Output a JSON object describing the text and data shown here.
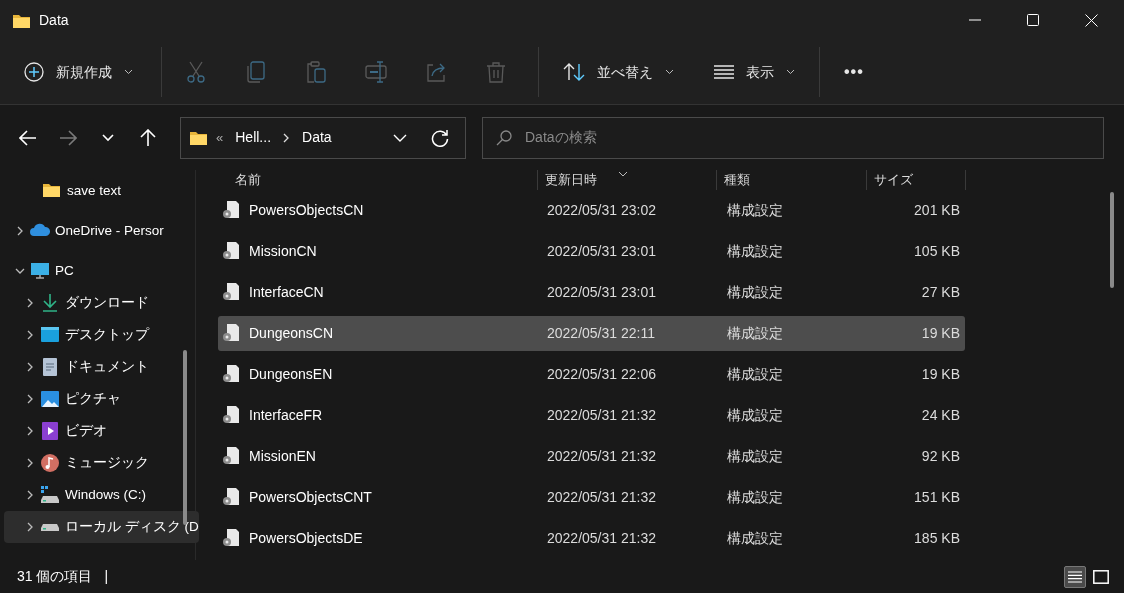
{
  "window": {
    "title": "Data"
  },
  "toolbar": [
    {
      "kind": "new",
      "label": "新規作成",
      "disabled": false
    },
    {
      "kind": "cut",
      "disabled": true
    },
    {
      "kind": "copy",
      "disabled": true
    },
    {
      "kind": "paste",
      "disabled": true
    },
    {
      "kind": "rename",
      "disabled": true
    },
    {
      "kind": "share",
      "disabled": true
    },
    {
      "kind": "delete",
      "disabled": true
    },
    {
      "kind": "sort",
      "label": "並べ替え",
      "disabled": false
    },
    {
      "kind": "view",
      "label": "表示",
      "disabled": false
    },
    {
      "kind": "more",
      "label": "•••",
      "disabled": false
    }
  ],
  "navigation": [
    {
      "kind": "back",
      "disabled": false
    },
    {
      "kind": "forward",
      "disabled": true
    },
    {
      "kind": "recent",
      "disabled": false
    },
    {
      "kind": "up",
      "disabled": false
    }
  ],
  "address_bar": {
    "overflow": "«",
    "crumbs": [
      "Hell...",
      "Data"
    ]
  },
  "search": {
    "placeholder": "Dataの検索"
  },
  "sidebar": {
    "items": [
      {
        "kind": "folder",
        "label": "save text",
        "selected": false
      },
      {
        "kind": "cloud",
        "label": "OneDrive - Persor",
        "expanded": false,
        "selected": false
      },
      {
        "kind": "pc",
        "label": "PC",
        "expanded": true,
        "selected": false,
        "children": [
          {
            "kind": "download",
            "label": "ダウンロード",
            "expanded": false,
            "selected": false
          },
          {
            "kind": "desktop",
            "label": "デスクトップ",
            "expanded": false,
            "selected": false
          },
          {
            "kind": "document",
            "label": "ドキュメント",
            "expanded": false,
            "selected": false
          },
          {
            "kind": "pictures",
            "label": "ピクチャ",
            "expanded": false,
            "selected": false
          },
          {
            "kind": "video",
            "label": "ビデオ",
            "expanded": false,
            "selected": false
          },
          {
            "kind": "music",
            "label": "ミュージック",
            "expanded": false,
            "selected": false
          },
          {
            "kind": "windows-drive",
            "label": "Windows (C:)",
            "expanded": false,
            "selected": false
          },
          {
            "kind": "drive",
            "label": "ローカル ディスク (D",
            "expanded": false,
            "selected": true
          }
        ]
      }
    ]
  },
  "table": {
    "columns": [
      {
        "label": "名前",
        "sorted": false
      },
      {
        "label": "更新日時",
        "sorted": true
      },
      {
        "label": "種類",
        "sorted": false
      },
      {
        "label": "サイズ",
        "sorted": false
      }
    ],
    "rows": [
      {
        "name": "PowersObjectsCN",
        "modified": "2022/05/31 23:02",
        "type": "構成設定",
        "size": "201 KB",
        "selected": false
      },
      {
        "name": "MissionCN",
        "modified": "2022/05/31 23:01",
        "type": "構成設定",
        "size": "105 KB",
        "selected": false
      },
      {
        "name": "InterfaceCN",
        "modified": "2022/05/31 23:01",
        "type": "構成設定",
        "size": "27 KB",
        "selected": false
      },
      {
        "name": "DungeonsCN",
        "modified": "2022/05/31 22:11",
        "type": "構成設定",
        "size": "19 KB",
        "selected": true
      },
      {
        "name": "DungeonsEN",
        "modified": "2022/05/31 22:06",
        "type": "構成設定",
        "size": "19 KB",
        "selected": false
      },
      {
        "name": "InterfaceFR",
        "modified": "2022/05/31 21:32",
        "type": "構成設定",
        "size": "24 KB",
        "selected": false
      },
      {
        "name": "MissionEN",
        "modified": "2022/05/31 21:32",
        "type": "構成設定",
        "size": "92 KB",
        "selected": false
      },
      {
        "name": "PowersObjectsCNT",
        "modified": "2022/05/31 21:32",
        "type": "構成設定",
        "size": "151 KB",
        "selected": false
      },
      {
        "name": "PowersObjectsDE",
        "modified": "2022/05/31 21:32",
        "type": "構成設定",
        "size": "185 KB",
        "selected": false
      }
    ]
  },
  "status_bar": {
    "count": "31 個の項目",
    "separator": "|",
    "views": [
      {
        "kind": "details",
        "selected": true
      },
      {
        "kind": "tiles",
        "selected": false
      }
    ]
  }
}
